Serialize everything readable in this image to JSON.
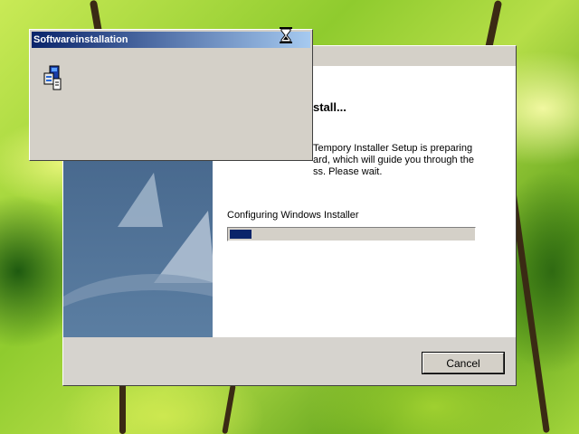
{
  "desktop": {
    "background": "green-leaves"
  },
  "wizard": {
    "heading": "stall...",
    "description_line1": "Tempory Installer Setup is preparing",
    "description_line2": "ard, which will guide you through the",
    "description_line3": "ss.  Please wait.",
    "progress_label": "Configuring Windows Installer",
    "progress_fraction": 0.09,
    "cancel_label": "Cancel"
  },
  "installer_window": {
    "title": "Softwareinstallation",
    "icon": "installer-icon"
  },
  "cursor": {
    "icon": "hourglass-icon"
  },
  "colors": {
    "title_gradient_start": "#0a246a",
    "title_gradient_end": "#a6caf0",
    "progress_fill": "#0a246a",
    "dialog_face": "#d4d0c8"
  }
}
